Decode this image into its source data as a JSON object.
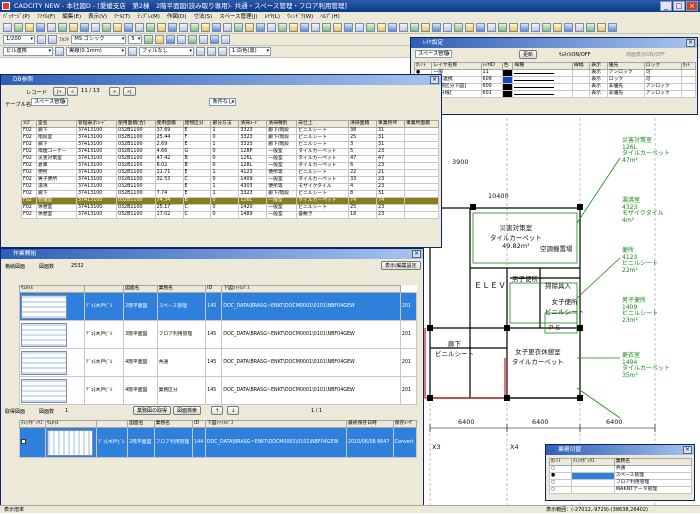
{
  "window": {
    "title": "CADCITY NEW - 本社図D - [愛媛支店　第2棟　2階平面図(読み取り専用)- 共通・スペース管理・フロア利用管理]"
  },
  "menu": [
    "ﾊﾟｯｹｰｼﾞ(P)",
    "ﾌｧｲﾙ(F)",
    "編集(E)",
    "表示(V)",
    "ﾂｰﾙ(T)",
    "ﾃﾝﾌﾟﾚ(M)",
    "作図(D)",
    "寸法(S)",
    "スペース管理(J)",
    "ﾚｲﾔ(L)",
    "ｳｨﾝﾄﾞｳ(W)",
    "ﾍﾙﾌﾟ(H)"
  ],
  "toolbar": {
    "font_label": "ﾌｫﾝﾄ",
    "font_value": "MS ゴシック",
    "size_value": "5",
    "scale_value": "1/200",
    "pattern_value": "実線(0.1mm)",
    "fill_value": "フィルなし",
    "layer_combo": "ビル連携",
    "color_combo": "1:白色(黒)"
  },
  "layer_panel": {
    "title": "ﾚｲﾔ設定",
    "combo": "スペース管理",
    "update": "更新",
    "thumb_toggle": "ｻﾑﾈｲﾙON/OFF",
    "mirror_toggle": "両面表示ON/OFF",
    "headers": [
      "ｶﾚﾝﾄ",
      "レイヤ名称",
      "ﾚｲﾔID",
      "色",
      "線種",
      "線幅",
      "表示",
      "優先",
      "ロック",
      "ｶｯﾄ"
    ],
    "rows": [
      [
        "●",
        "一般",
        "11",
        "",
        "",
        "",
        "表示",
        "アンロック",
        "可"
      ],
      [
        "",
        "ビル連携",
        "609",
        "",
        "",
        "",
        "表示",
        "ロック",
        "可"
      ],
      [
        "",
        "[業務区分下図]",
        "600",
        "",
        "",
        "",
        "表示",
        "非優先",
        "アンロック"
      ],
      [
        "",
        "[区分線]",
        "601",
        "",
        "",
        "",
        "表示",
        "非優先",
        "アンロック"
      ]
    ]
  },
  "db_panel": {
    "title": "DB参照",
    "record_label": "レコード",
    "record_value": "11 / 13",
    "table_label": "テーブル名",
    "table_value": "スペース管理",
    "filter_value": "条件なし",
    "headers": [
      "ﾌﾛｱ",
      "室名",
      "管理表示ｺｰﾄﾞ",
      "使用面積(合)",
      "使用面積",
      "建物区分",
      "部分方法",
      "清掃ｺｰﾄﾞ",
      "清掃種別",
      "床仕上",
      "清掃面積",
      "事業所坪",
      "事業所面積"
    ],
    "rows": [
      [
        "F02",
        "廊下",
        "37413100",
        "032B1100",
        "37.69",
        "E",
        "1",
        "3323",
        "廊下/階段",
        "ビニルシート",
        "38",
        "31",
        ""
      ],
      [
        "F02",
        "階段室",
        "37413100",
        "032B1100",
        "25.44",
        "F",
        "0",
        "3323",
        "廊下/階段",
        "ビニルシート",
        "25",
        "31",
        ""
      ],
      [
        "F02",
        "廊下",
        "37413100",
        "032B1100",
        "2.69",
        "E",
        "1",
        "3323",
        "廊下/階段",
        "ビニルシート",
        "3",
        "31",
        ""
      ],
      [
        "F02",
        "喫煙コーナー",
        "37413100",
        "032B1100",
        "4.66",
        "G",
        "0",
        "128P",
        "一般室",
        "タイルカーペット",
        "5",
        "23",
        ""
      ],
      [
        "F02",
        "災害対策室",
        "37413100",
        "032B1100",
        "47.42",
        "B",
        "0",
        "126L",
        "一般室",
        "タイルカーペット",
        "47",
        "47",
        ""
      ],
      [
        "F02",
        "倉庫",
        "37413100",
        "032B1100",
        "6.02",
        "B",
        "0",
        "128L",
        "一般室",
        "タイルカーペット",
        "6",
        "23",
        ""
      ],
      [
        "F02",
        "便所",
        "37413100",
        "032B1100",
        "21.71",
        "E",
        "1",
        "4123",
        "便所等",
        "ビニルシート",
        "22",
        "21",
        ""
      ],
      [
        "F02",
        "男子便所",
        "37413100",
        "032B1100",
        "32.53",
        "C",
        "0",
        "1409",
        "一般室",
        "タイルカーペット",
        "33",
        "23",
        ""
      ],
      [
        "F02",
        "湯沸",
        "37413100",
        "032B1100",
        "",
        "E",
        "1",
        "4303",
        "便所等",
        "モザイクタイル",
        "4",
        "23",
        ""
      ],
      [
        "F02",
        "廊下",
        "37413100",
        "032B1100",
        "7.74",
        "E",
        "1",
        "3323",
        "廊下/階段",
        "ビニルシート",
        "8",
        "31",
        ""
      ],
      [
        "F02",
        "会議室",
        "37413100",
        "032B1100",
        "74.34",
        "B",
        "0",
        "126L",
        "一般室",
        "タイルカーペット",
        "74",
        "74",
        ""
      ],
      [
        "F02",
        "休憩室",
        "37413100",
        "032B1100",
        "25.17",
        "C",
        "0",
        "1420",
        "一般室",
        "ビニルシート",
        "25",
        "23",
        ""
      ],
      [
        "F02",
        "休憩室",
        "37413100",
        "032B1100",
        "17.02",
        "C",
        "0",
        "1489",
        "一般室",
        "畳敷き",
        "18",
        "23",
        ""
      ]
    ]
  },
  "work_panel": {
    "title": "作業開始",
    "loc_label": "格納図面",
    "draw_label": "図面数",
    "draw_count": "2532",
    "open_btn": "表示/編集設定",
    "headers": [
      "ｻﾑﾈｲﾙ",
      "",
      "図面名",
      "業務名",
      "ID",
      "下図ﾌｧｲﾙﾊﾟｽ"
    ],
    "rows": [
      [
        "ﾃﾞｺﾓ木戸ﾋﾞﾙ",
        "2階平面図",
        "スペース管理",
        "145",
        "DOC_DATA\\BRASG~ENKT\\DOCM0001\\0101\\NBF04GEW",
        "201"
      ],
      [
        "ﾃﾞｺﾓ木戸ﾋﾞﾙ",
        "3階平面図",
        "フロア利用管理",
        "145",
        "DOC_DATA\\BRASG~ENKT\\DOCM0001\\0101\\NBF04GEW",
        "201"
      ],
      [
        "ﾃﾞｺﾓ木戸ﾋﾞﾙ",
        "4階平面図",
        "共通",
        "145",
        "DOC_DATA\\BRASG~ENKT\\DOCM0001\\0101\\NBF04GEW",
        "201"
      ],
      [
        "ﾃﾞｺﾓ木戸ﾋﾞﾙ",
        "4階平面図",
        "業務区分",
        "145",
        "DOC_DATA\\BRASG~ENKT\\DOCM0001\\0101\\NBF04GEW",
        "201"
      ]
    ],
    "work_label": "取得図面",
    "work_count_label": "図面数",
    "work_count": "1",
    "btn_get": "業務図の取得",
    "btn_search": "図面検索",
    "page": "1 / 1",
    "headers2": [
      "ﾁｪｯｸﾎﾞｯｸｽ",
      "ｻﾑﾈｲﾙ",
      "",
      "図面名",
      "業務名",
      "ID",
      "下図ﾌｧｲﾙﾊﾟｽ",
      "最終保存日時",
      "保存ﾕｰｻﾞ"
    ],
    "row2": [
      "ﾃﾞｺﾓ木戸ﾋﾞﾙ",
      "2階平面図",
      "フロア利用管理",
      "144",
      "DOC_DATA\\BRASG~ENKT\\DOCM0001\\0101\\NBF04GEW",
      "2010/06/08 8647",
      "Convert"
    ]
  },
  "task_panel": {
    "title": "業務切替",
    "headers": [
      "ｶﾚﾝﾄ",
      "ﾁｪｯｸﾎﾞｯｸｽ",
      "業務名"
    ],
    "rows": [
      "共通",
      "スペース管理",
      "フロア利用管理",
      "WAKNTデータ管理"
    ]
  },
  "plan": {
    "rooms": [
      {
        "name": "災害対策室",
        "sub": "タイルカーペット",
        "area": "49.82m²"
      },
      {
        "name": "ＥＬＥＶ",
        "sub": "6 6"
      },
      {
        "name": "男子便所",
        "sub": ""
      },
      {
        "name": "女子便所",
        "sub": "ビニルシート"
      },
      {
        "name": "廊下",
        "sub": "ビニルシート"
      },
      {
        "name": "女子更衣休憩室",
        "sub": "タイルカーペット"
      },
      {
        "name": "空調機置場",
        "sub": ""
      },
      {
        "name": "掃除具入",
        "sub": ""
      },
      {
        "name": "ＰＳ",
        "sub": ""
      }
    ],
    "green": [
      [
        "災害対策室",
        "126L",
        "タイルカーペット",
        "47m²"
      ],
      [
        "湯沸室",
        "4323",
        "モザイクタイル",
        "4m²"
      ],
      [
        "便所",
        "4123",
        "ビニルシート",
        "22m²"
      ],
      [
        "男子便所",
        "1409",
        "ビニルシート",
        "23m²"
      ],
      [
        "更衣室",
        "1494",
        "タイルカーペット",
        "35m²"
      ]
    ],
    "dims": [
      "6400",
      "6400",
      "6400",
      "X3",
      "X4",
      "X5",
      "10400",
      "3900"
    ]
  },
  "status": {
    "text": "表示倍率",
    "coord": "表示範囲：(-27012,-9729)-(38638,26402)"
  },
  "colors": {
    "titlebar": "#1d4a98",
    "selected_row": "#8a7e1c",
    "selected_blue": "#2f7fdc",
    "green": "#1a8a1a"
  }
}
